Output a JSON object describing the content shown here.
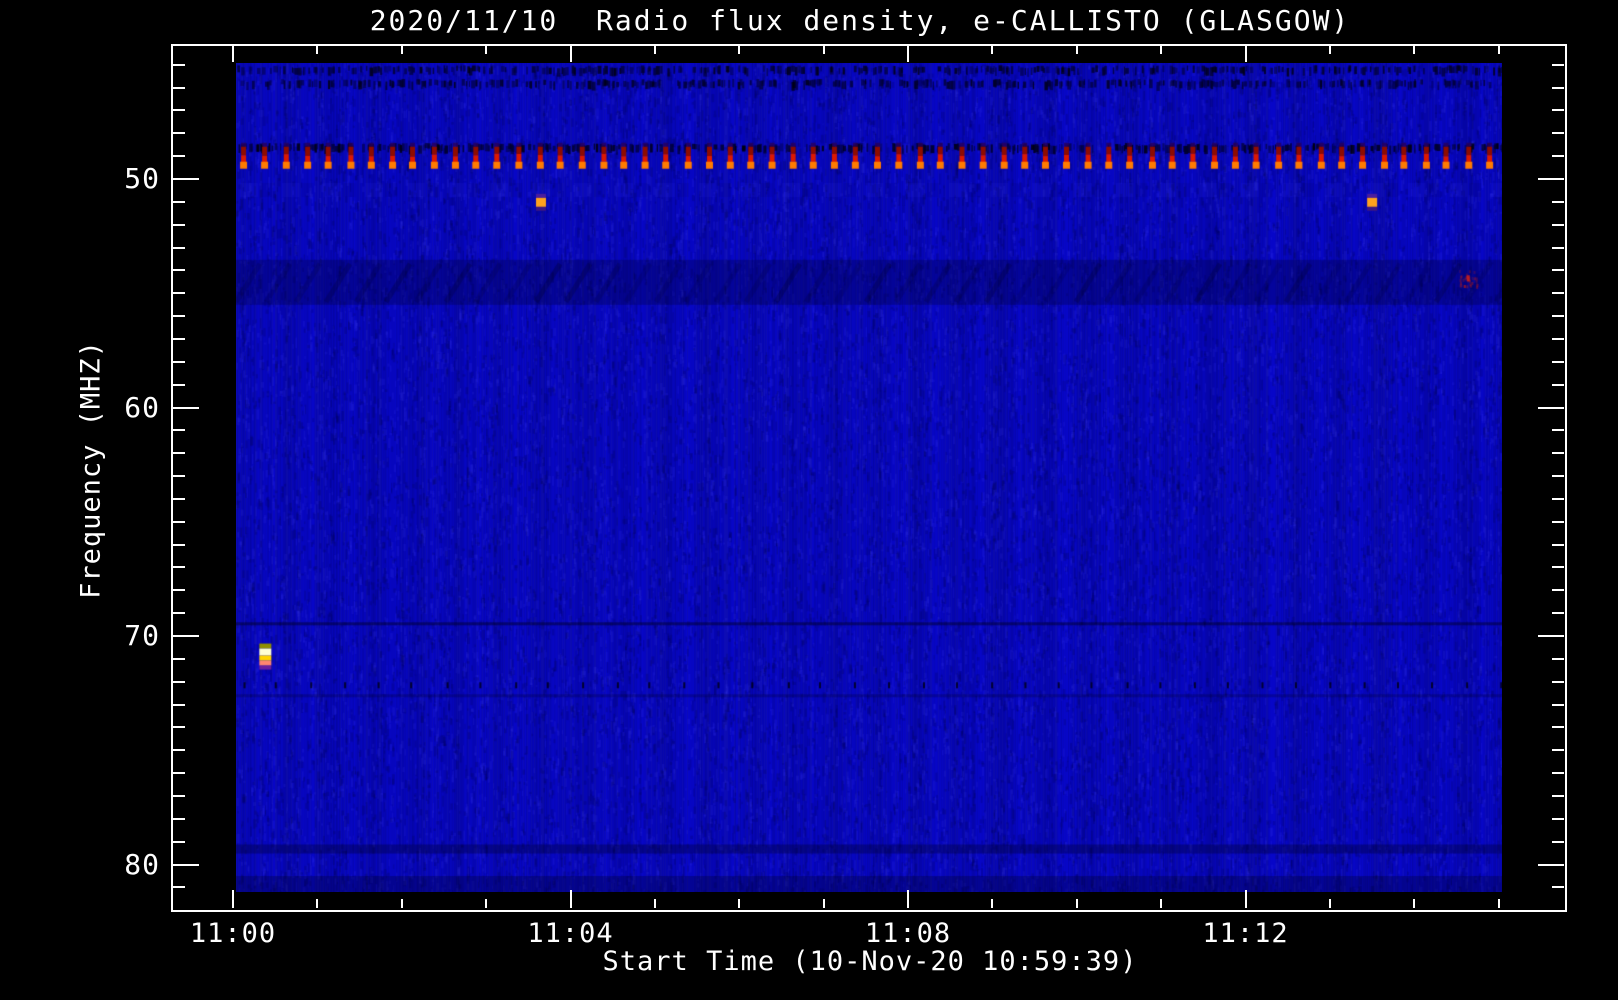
{
  "title": "2020/11/10  Radio flux density, e-CALLISTO (GLASGOW)",
  "chart_data": {
    "type": "heatmap",
    "subtype": "radio-spectrogram",
    "date": "2020/11/10",
    "instrument": "e-CALLISTO (GLASGOW)",
    "xlabel": "Start Time (10-Nov-20 10:59:39)",
    "ylabel": "Frequency (MHZ)",
    "x_axis": {
      "start_time": "10:59:39",
      "major_ticks": [
        {
          "label": "11:00",
          "t_min": 0
        },
        {
          "label": "11:04",
          "t_min": 4
        },
        {
          "label": "11:08",
          "t_min": 8
        },
        {
          "label": "11:12",
          "t_min": 12
        }
      ],
      "minor_tick_interval_min": 1,
      "data_span_min": [
        0.05,
        15.05
      ]
    },
    "y_axis": {
      "unit": "MHz",
      "major_ticks": [
        {
          "label": "50",
          "mhz": 50
        },
        {
          "label": "60",
          "mhz": 60
        },
        {
          "label": "70",
          "mhz": 70
        },
        {
          "label": "80",
          "mhz": 80
        }
      ],
      "minor_tick_interval_mhz": 1,
      "data_range_mhz": [
        45.0,
        81.2
      ]
    },
    "colors": {
      "outside": "#000000",
      "base_blue": "#0807c9",
      "rfi_red_dark": "#8f0c00",
      "rfi_red": "#dd1800",
      "rfi_orange": "#ff7b00",
      "burst_orange": "#ffa21e",
      "burst_white": "#ffffd2",
      "faint_red": "#b22222"
    },
    "features": {
      "interference_dash_line": {
        "freq_mhz": 49.2,
        "period_s": 15,
        "description": "periodic red/orange RFI dashes across full time span"
      },
      "noise_speckle_bands_mhz": [
        45.2,
        45.8,
        48.6
      ],
      "dark_bands_mhz": [
        54.5,
        69.4,
        72.2,
        79.3
      ],
      "point_events": [
        {
          "time": "11:03:39",
          "freq_mhz": 51.0,
          "style": "orange-dot"
        },
        {
          "time": "11:13:30",
          "freq_mhz": 51.0,
          "style": "orange-dot"
        },
        {
          "time": "11:00:23",
          "freq_mhz": 70.9,
          "style": "bright-multicolor"
        },
        {
          "time": "11:14:38",
          "freq_mhz": 54.3,
          "style": "faint-red"
        }
      ]
    }
  }
}
